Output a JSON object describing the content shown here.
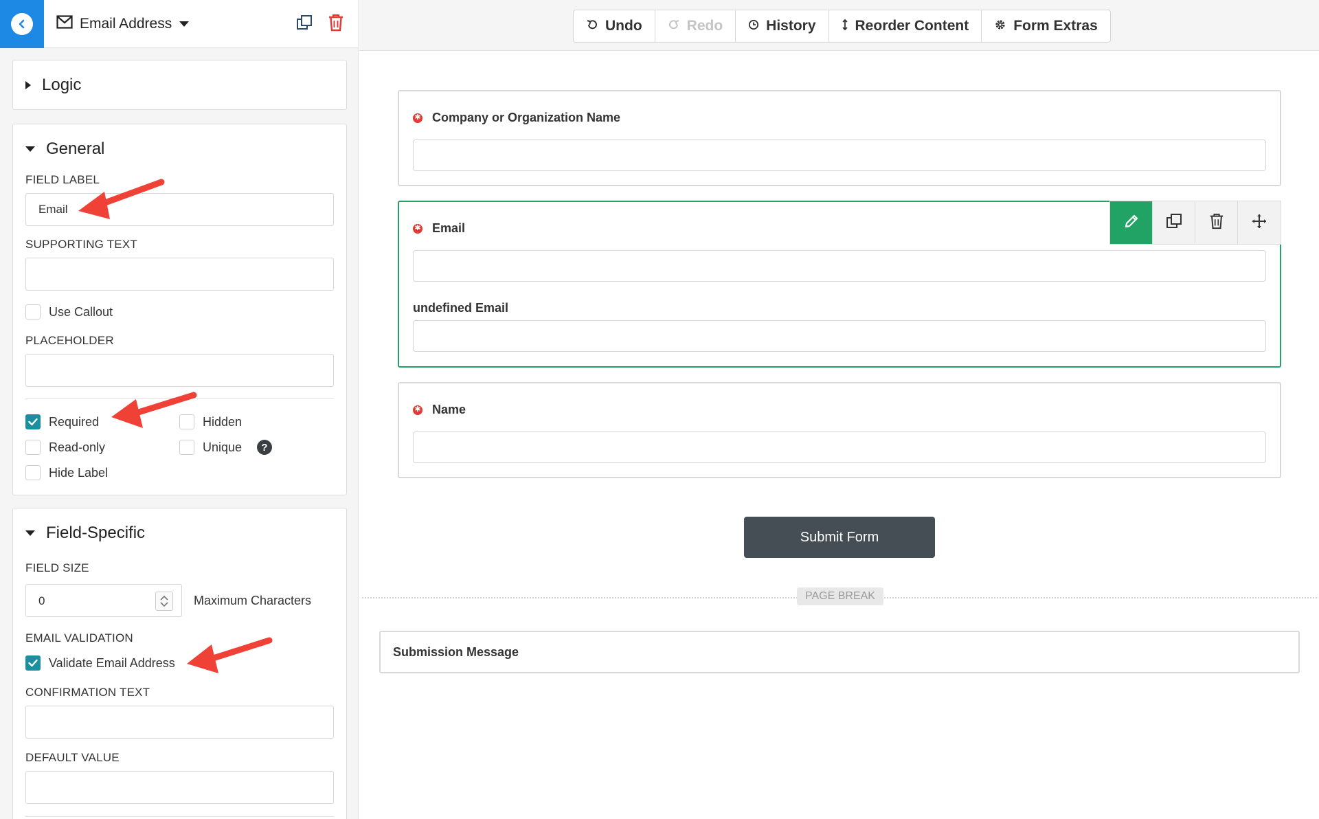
{
  "sidebar": {
    "field_type_label": "Email Address",
    "logic": {
      "title": "Logic"
    },
    "general": {
      "title": "General",
      "field_label_heading": "FIELD LABEL",
      "field_label_value": "Email",
      "supporting_text_heading": "SUPPORTING TEXT",
      "supporting_text_value": "",
      "use_callout": {
        "label": "Use Callout",
        "checked": false
      },
      "placeholder_heading": "PLACEHOLDER",
      "placeholder_value": "",
      "options": {
        "required": {
          "label": "Required",
          "checked": true
        },
        "hidden": {
          "label": "Hidden",
          "checked": false
        },
        "read_only": {
          "label": "Read-only",
          "checked": false
        },
        "unique": {
          "label": "Unique",
          "checked": false
        },
        "hide_label": {
          "label": "Hide Label",
          "checked": false
        }
      },
      "help_glyph": "?"
    },
    "field_specific": {
      "title": "Field-Specific",
      "field_size_heading": "FIELD SIZE",
      "field_size_value": "0",
      "field_size_unit": "Maximum Characters",
      "email_validation_heading": "EMAIL VALIDATION",
      "validate_email": {
        "label": "Validate Email Address",
        "checked": true
      },
      "confirmation_text_heading": "CONFIRMATION TEXT",
      "confirmation_text_value": "",
      "default_value_heading": "DEFAULT VALUE",
      "default_value_value": ""
    }
  },
  "toolbar": {
    "undo": "Undo",
    "redo": "Redo",
    "history": "History",
    "reorder": "Reorder Content",
    "form_extras": "Form Extras"
  },
  "form": {
    "fields": [
      {
        "label": "Company or Organization Name",
        "required": true
      },
      {
        "label": "Email",
        "required": true,
        "confirm_label": "undefined Email"
      },
      {
        "label": "Name",
        "required": true
      }
    ],
    "submit_label": "Submit Form",
    "page_break_label": "PAGE BREAK",
    "submission_message_label": "Submission Message"
  },
  "colors": {
    "accent_blue": "#1e88e5",
    "active_green": "#21a366",
    "checkbox_teal": "#1a8fa0",
    "required_red": "#e53935",
    "submit_dark": "#454d55",
    "annotation_red": "#ef4136"
  },
  "icons": {
    "back": "chevron-left-icon",
    "field_type": "envelope-icon",
    "dropdown": "caret-down-icon",
    "duplicate": "duplicate-icon",
    "delete": "trash-icon",
    "undo": "undo-icon",
    "redo": "redo-icon",
    "history": "clock-icon",
    "reorder": "arrows-vertical-icon",
    "form_extras": "gear-icon",
    "edit": "pencil-icon",
    "move": "move-icon",
    "help": "help-icon"
  }
}
